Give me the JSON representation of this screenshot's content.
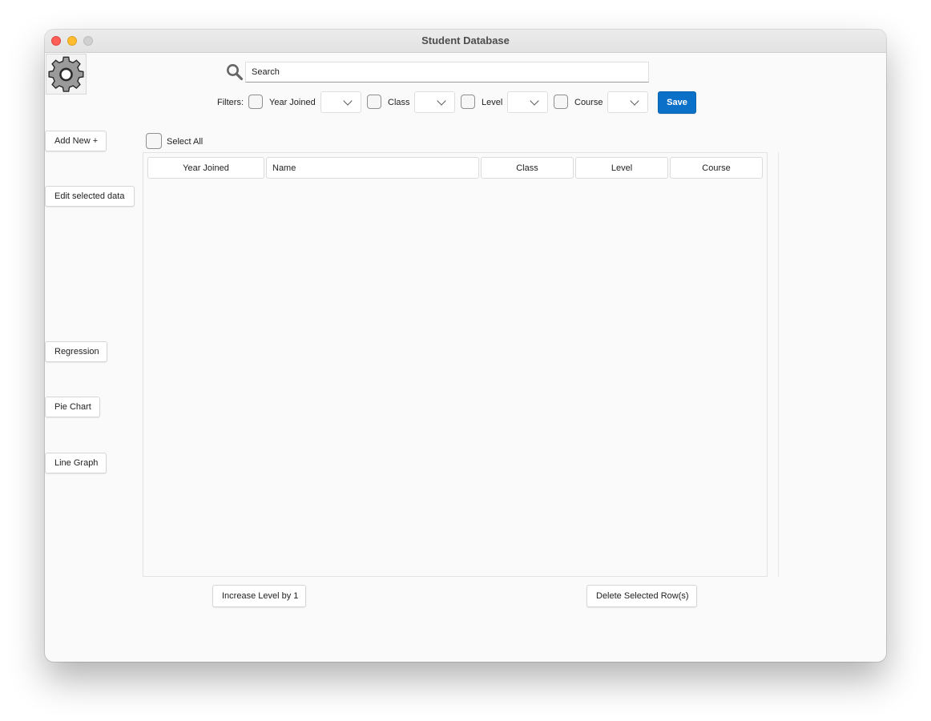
{
  "window": {
    "title": "Student Database"
  },
  "toolbar": {
    "search_placeholder": "Search",
    "filters_label": "Filters:",
    "filters": [
      {
        "label": "Year Joined"
      },
      {
        "label": "Class"
      },
      {
        "label": "Level"
      },
      {
        "label": "Course"
      }
    ],
    "save_label": "Save"
  },
  "sidebar": {
    "add_new": "Add New +",
    "edit_selected": "Edit selected data",
    "regression": "Regression",
    "pie_chart": "Pie Chart",
    "line_graph": "Line Graph"
  },
  "table": {
    "select_all_label": "Select All",
    "columns": [
      "Year Joined",
      "Name",
      "Class",
      "Level",
      "Course"
    ],
    "rows": []
  },
  "footer": {
    "increase_level": "Increase Level by 1",
    "delete_rows": "Delete Selected Row(s)"
  },
  "colors": {
    "accent": "#0a70c8",
    "close": "#ff5f57",
    "minimize": "#febc2e",
    "maximize": "#d0d0d0"
  },
  "icons": {
    "settings": "gear-icon",
    "search": "search-icon"
  }
}
